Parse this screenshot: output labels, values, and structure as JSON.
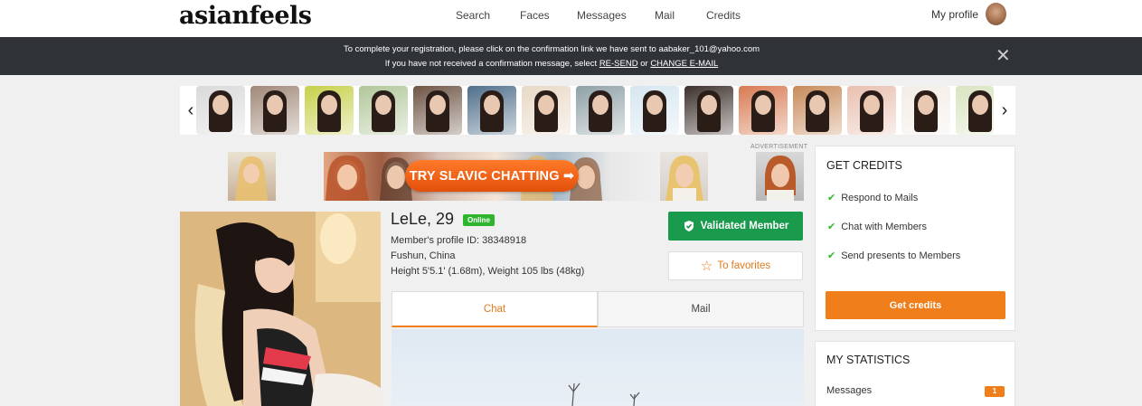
{
  "header": {
    "logo": "asianfeels",
    "nav": [
      "Search",
      "Faces",
      "Messages",
      "Mail",
      "Credits"
    ],
    "my_profile": "My profile"
  },
  "notice": {
    "line1": "To complete your registration, please click on the confirmation link we have sent to aabaker_101@yahoo.com",
    "line2_prefix": "If you have not received a confirmation message, select ",
    "resend": "RE-SEND",
    "or": " or ",
    "change_email": "CHANGE E-MAIL",
    "close": "✕"
  },
  "carousel": {
    "prev": "‹",
    "next": "›",
    "thumb_colors": [
      "#d9d9d9",
      "#a08878",
      "#c6d04a",
      "#b1c79a",
      "#6e5444",
      "#4f6e8a",
      "#e9d9c6",
      "#8ea0a6",
      "#d6e6f0",
      "#3c302c",
      "#d87a52",
      "#c88a5a",
      "#e9c0b0",
      "#f3ece6",
      "#d8e4c0"
    ]
  },
  "ad": {
    "label": "ADVERTISEMENT",
    "button": "TRY SLAVIC CHATTING ➡"
  },
  "profile": {
    "name": "LeLe, 29",
    "online": "Online",
    "id_line": "Member's profile ID: 38348918",
    "location": "Fushun, China",
    "stats": "Height 5'5.1' (1.68m), Weight 105 lbs (48kg)",
    "validated": "Validated Member",
    "favorites": "To favorites"
  },
  "tabs": {
    "chat": "Chat",
    "mail": "Mail"
  },
  "credits_panel": {
    "title": "GET CREDITS",
    "items": [
      "Respond to Mails",
      "Chat with Members",
      "Send presents to Members"
    ],
    "button": "Get credits"
  },
  "stats_panel": {
    "title": "MY STATISTICS",
    "messages_label": "Messages",
    "messages_count": "1"
  },
  "colors": {
    "accent": "#f07e1a",
    "validated": "#1a9a4c",
    "online": "#2eb52e",
    "notice_bg": "#2f3338"
  }
}
